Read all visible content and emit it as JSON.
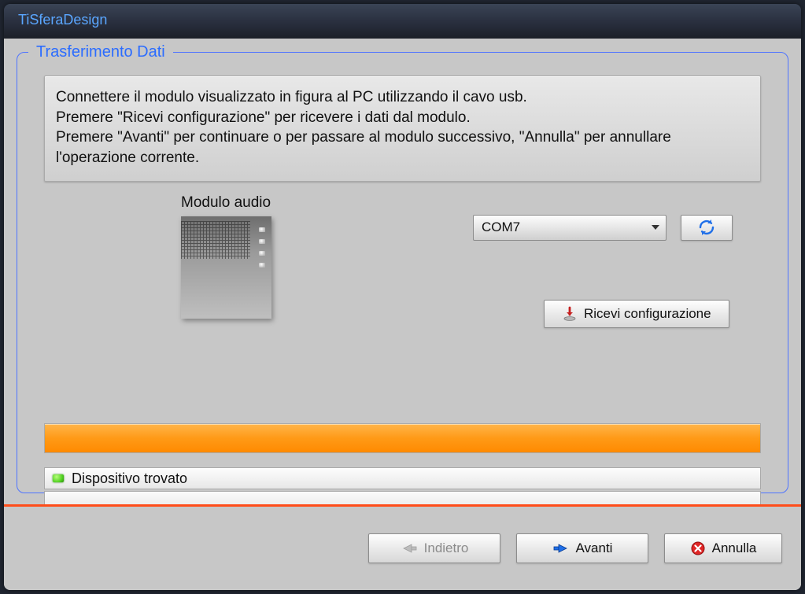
{
  "titlebar": {
    "app_name": "TiSferaDesign"
  },
  "panel": {
    "legend": "Trasferimento Dati",
    "instructions": "Connettere il modulo visualizzato in figura al PC utilizzando il cavo usb.\nPremere \"Ricevi configurazione\" per ricevere i dati dal modulo.\nPremere \"Avanti\" per continuare o per passare al modulo successivo, \"Annulla\" per annullare l'operazione corrente.",
    "module_label": "Modulo audio",
    "port": {
      "selected": "COM7"
    },
    "receive_label": "Ricevi configurazione",
    "status_text": "Dispositivo trovato",
    "progress_percent": 100
  },
  "buttons": {
    "back": "Indietro",
    "next": "Avanti",
    "cancel": "Annulla"
  },
  "colors": {
    "accent": "#ff8a00",
    "link": "#2b6cff",
    "separator": "#ff4d1a"
  },
  "icons": {
    "refresh": "refresh-icon",
    "receive": "download-icon",
    "back": "arrow-left-icon",
    "next": "arrow-right-icon",
    "cancel": "close-circle-icon",
    "status": "status-led-icon"
  }
}
